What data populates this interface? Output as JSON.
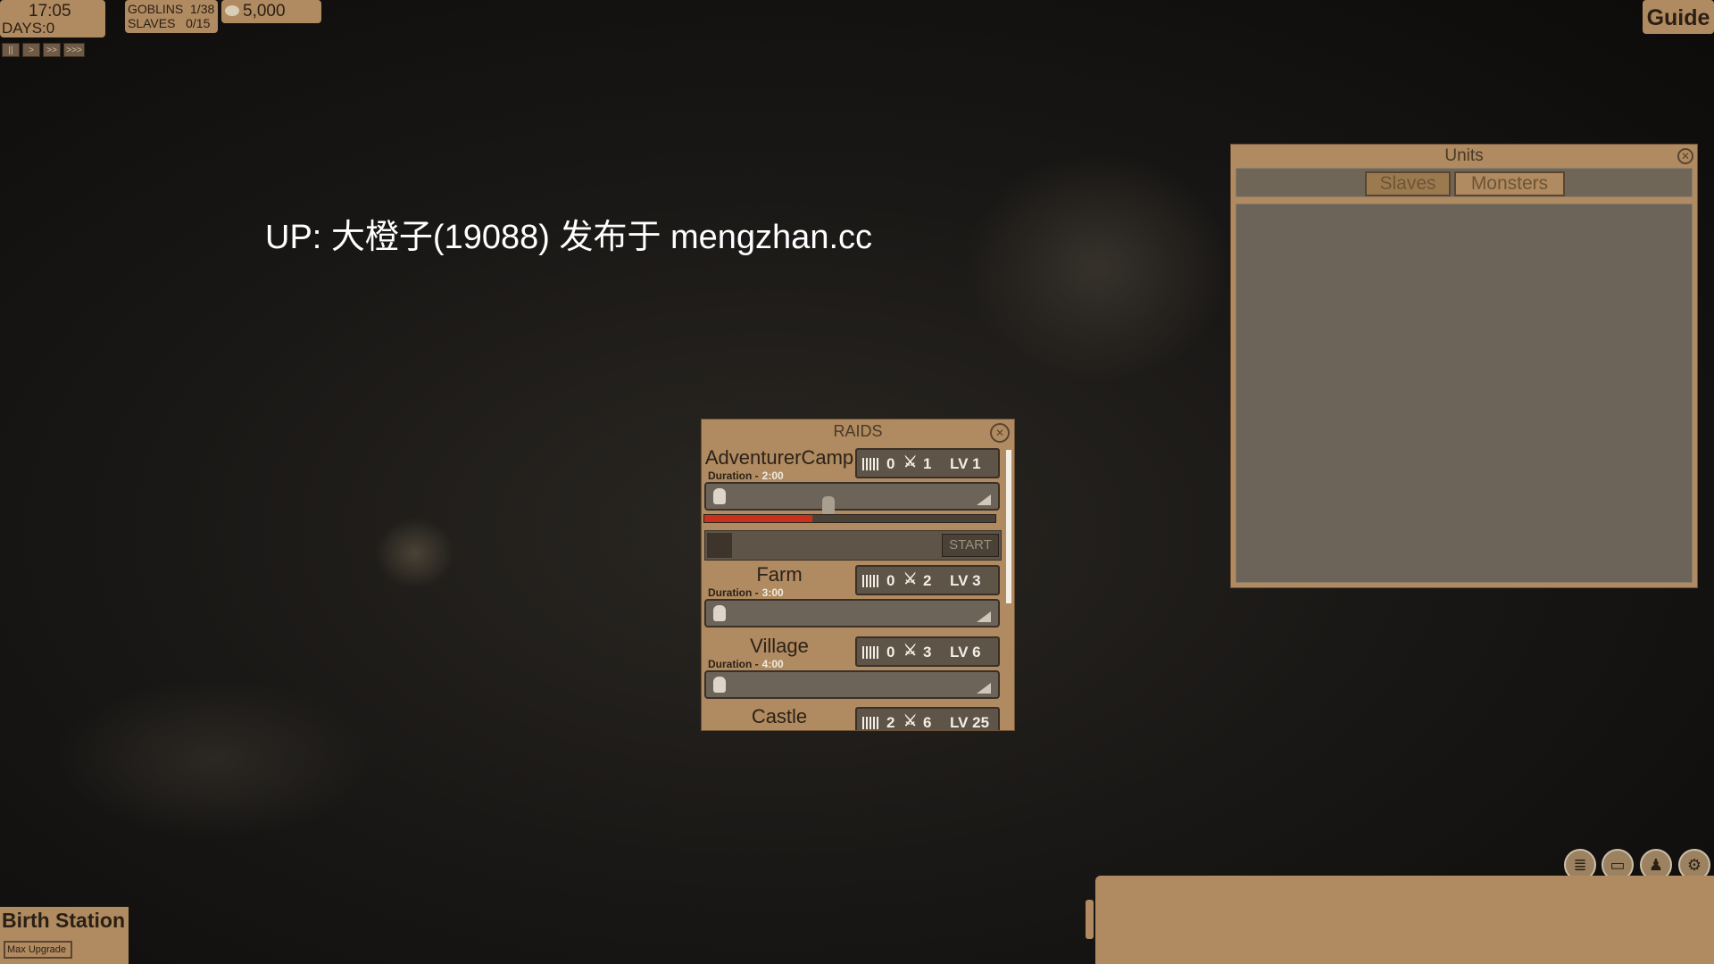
{
  "hud": {
    "time": "17:05",
    "days_label": "DAYS:",
    "days_value": "0",
    "goblins": "GOBLINS  1/38",
    "slaves": "SLAVES   0/15",
    "gold": "5,000",
    "guide_label": "Guide",
    "speed_buttons": [
      "||",
      ">",
      ">>",
      ">>>"
    ]
  },
  "watermark": "UP: 大橙子(19088) 发布于 mengzhan.cc",
  "units_panel": {
    "title": "Units",
    "tabs": [
      "Slaves",
      "Monsters"
    ],
    "active_tab": "Slaves"
  },
  "raids_panel": {
    "title": "RAIDS",
    "duration_label": "Duration -",
    "start_label": "START",
    "entries": [
      {
        "name": "AdventurerCamp",
        "duration": "2:00",
        "prisoners": "0",
        "soldiers": "1",
        "level": "LV 1"
      },
      {
        "name": "Farm",
        "duration": "3:00",
        "prisoners": "0",
        "soldiers": "2",
        "level": "LV 3"
      },
      {
        "name": "Village",
        "duration": "4:00",
        "prisoners": "0",
        "soldiers": "3",
        "level": "LV 6"
      },
      {
        "name": "Castle",
        "duration": "",
        "prisoners": "2",
        "soldiers": "6",
        "level": "LV 25"
      }
    ],
    "raid_progress": 0.37
  },
  "building": {
    "name": "Birth Station",
    "button": "Max Upgrade"
  },
  "toolbar_icons": [
    "scroll-icon",
    "map-icon",
    "character-icon",
    "gear-icon"
  ],
  "colors": {
    "panel": "#b08a60",
    "progress_fill": "#c8321c",
    "slot_bg": "#6c6459"
  }
}
